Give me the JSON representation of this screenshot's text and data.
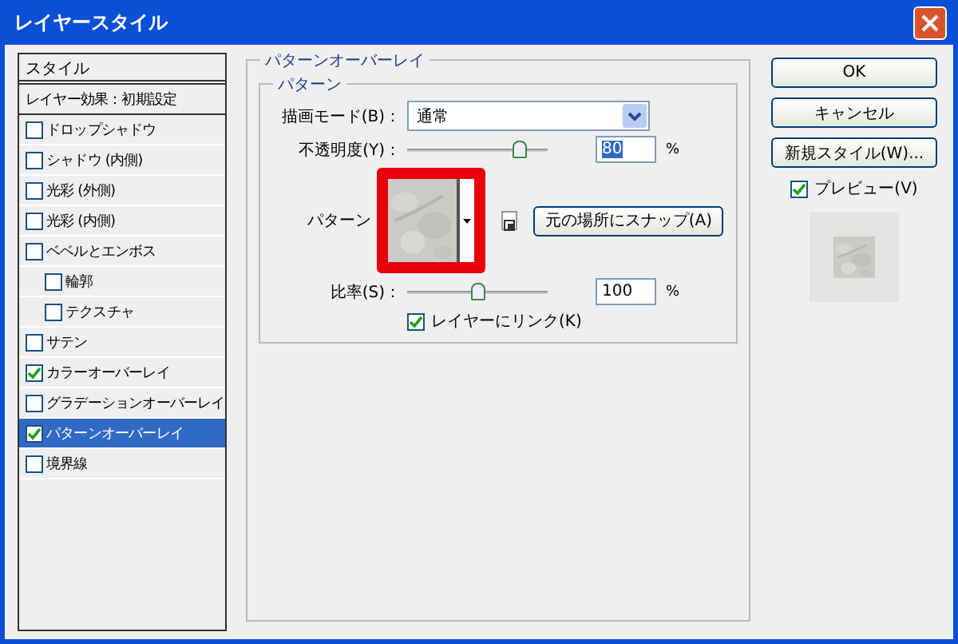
{
  "window": {
    "title": "レイヤースタイル"
  },
  "styles_panel": {
    "header": "スタイル",
    "items": [
      {
        "label": "レイヤー効果：初期設定",
        "kind": "heading",
        "selected": false
      },
      {
        "label": "ドロップシャドウ",
        "kind": "effect",
        "checked": false,
        "selected": false
      },
      {
        "label": "シャドウ (内側)",
        "kind": "effect",
        "checked": false,
        "selected": false
      },
      {
        "label": "光彩 (外側)",
        "kind": "effect",
        "checked": false,
        "selected": false
      },
      {
        "label": "光彩 (内側)",
        "kind": "effect",
        "checked": false,
        "selected": false
      },
      {
        "label": "ベベルとエンボス",
        "kind": "effect",
        "checked": false,
        "selected": false,
        "children": [
          {
            "label": "輪郭",
            "kind": "effect",
            "checked": false,
            "selected": false
          },
          {
            "label": "テクスチャ",
            "kind": "effect",
            "checked": false,
            "selected": false
          }
        ]
      },
      {
        "label": "サテン",
        "kind": "effect",
        "checked": false,
        "selected": false
      },
      {
        "label": "カラーオーバーレイ",
        "kind": "effect",
        "checked": true,
        "selected": false
      },
      {
        "label": "グラデーションオーバーレイ",
        "kind": "effect",
        "checked": false,
        "selected": false
      },
      {
        "label": "パターンオーバーレイ",
        "kind": "effect",
        "checked": true,
        "selected": true
      },
      {
        "label": "境界線",
        "kind": "effect",
        "checked": false,
        "selected": false
      }
    ]
  },
  "pattern_overlay": {
    "title": "パターンオーバーレイ",
    "group": "パターン",
    "blend_mode": {
      "label": "描画モード(B)：",
      "value": "通常"
    },
    "opacity": {
      "label": "不透明度(Y)：",
      "level": 0.8,
      "value": "80",
      "highlighted": true,
      "unit": "%"
    },
    "pattern": {
      "label": "パターン",
      "snap_button": "元の場所にスナップ(A)"
    },
    "scale": {
      "label": "比率(S)：",
      "level": 0.5,
      "value": "100",
      "highlighted": false,
      "unit": "%"
    },
    "link": {
      "label": "レイヤーにリンク(K)",
      "checked": true
    }
  },
  "buttons": [
    {
      "label": "OK"
    },
    {
      "label": "キャンセル"
    },
    {
      "label": "新規スタイル(W)..."
    }
  ],
  "preview": {
    "label": "プレビュー(V)",
    "checked": true
  }
}
